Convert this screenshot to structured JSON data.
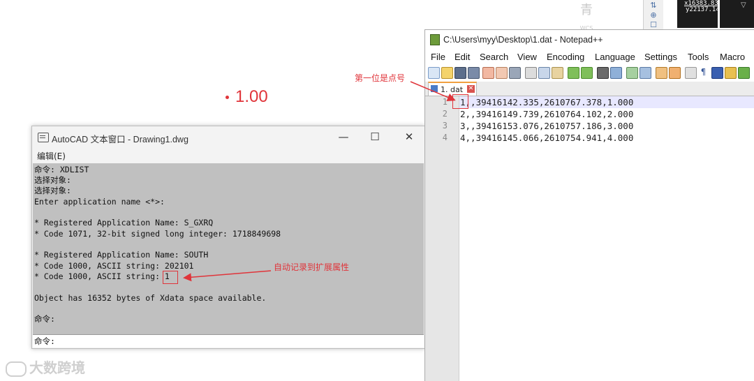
{
  "cad": {
    "point_label": "1.00",
    "top_fragment": "青",
    "wcs_label": "WCS",
    "coords": {
      "line1": "x16383.83",
      "line2": "y22137.14"
    }
  },
  "acad_window": {
    "title": "AutoCAD 文本窗口 - Drawing1.dwg",
    "menu": [
      "编辑(E)"
    ],
    "buttons": {
      "minimize": "—",
      "maximize": "☐",
      "close": "✕"
    },
    "lines": [
      "命令: XDLIST",
      "选择对象:",
      "选择对象:",
      "Enter application name <*>:",
      "",
      "* Registered Application Name: S_GXRQ",
      "* Code 1071, 32-bit signed long integer: 1718849698",
      "",
      "* Registered Application Name: SOUTH",
      "* Code 1000, ASCII string: 202101",
      "* Code 1000, ASCII string: 1",
      "",
      "Object has 16352 bytes of Xdata space available.",
      "",
      "命令:"
    ],
    "command_prompt": "命令:"
  },
  "notepad": {
    "title": "C:\\Users\\myy\\Desktop\\1.dat - Notepad++",
    "menu": [
      "File",
      "Edit",
      "Search",
      "View",
      "Encoding",
      "Language",
      "Settings",
      "Tools",
      "Macro"
    ],
    "tab": {
      "label": "1. dat",
      "close": "✕"
    },
    "lines": [
      {
        "num": "1",
        "text": "1,,39416142.335,2610767.378,1.000"
      },
      {
        "num": "2",
        "text": "2,,39416149.739,2610764.102,2.000"
      },
      {
        "num": "3",
        "text": "3,,39416153.076,2610757.186,3.000"
      },
      {
        "num": "4",
        "text": "4,,39416145.066,2610754.941,4.000"
      }
    ]
  },
  "annotations": {
    "first_is_point_no": "第一位是点号",
    "auto_record": "自动记录到扩展属性"
  },
  "watermark": "大数跨境",
  "colors": {
    "annotation": "#e0343a",
    "cad_console_bg": "#c0c0c0",
    "current_line": "#e8e8ff"
  }
}
